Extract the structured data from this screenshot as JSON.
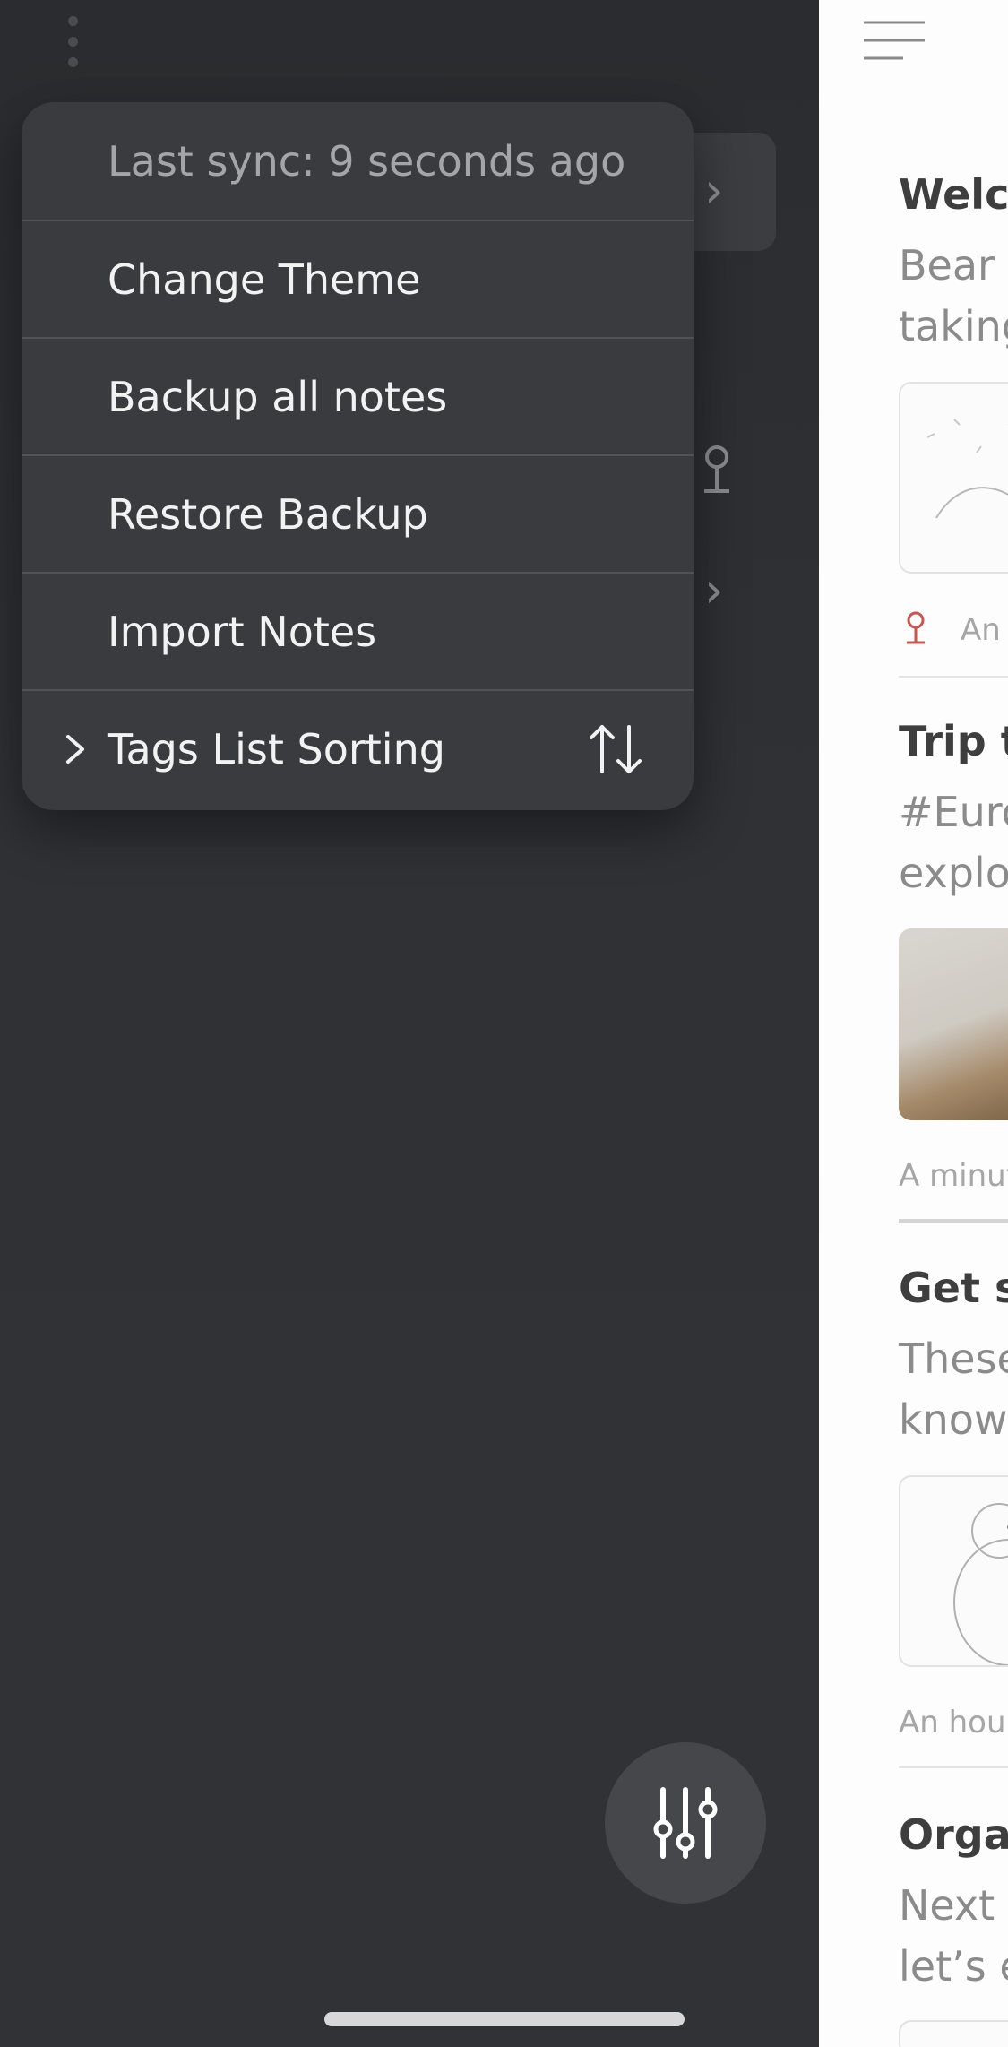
{
  "menu": {
    "items": [
      {
        "label": "Last sync: 9 seconds ago"
      },
      {
        "label": "Change Theme"
      },
      {
        "label": "Backup all notes"
      },
      {
        "label": "Restore Backup"
      },
      {
        "label": "Import Notes"
      },
      {
        "label": "Tags List Sorting"
      }
    ],
    "sort_icon": "sort-arrows-icon",
    "chevron_icon": "chevron-right-icon"
  },
  "notes": [
    {
      "title": "Welco",
      "body": [
        "Bear i",
        "taking"
      ],
      "meta": "An"
    },
    {
      "title": "Trip t",
      "body": [
        "#Euro",
        "explor"
      ],
      "meta": "A minut"
    },
    {
      "title": "Get st",
      "body": [
        "These",
        "know"
      ],
      "meta": "An hour"
    },
    {
      "title": "Organ",
      "body": [
        "Next c",
        "let’s e"
      ]
    }
  ],
  "colors": {
    "sidebar_bg": "#2f3135",
    "menu_bg": "#3a3b3f",
    "pin_red": "#c6564f",
    "notes_bg": "#fdfdfd"
  }
}
